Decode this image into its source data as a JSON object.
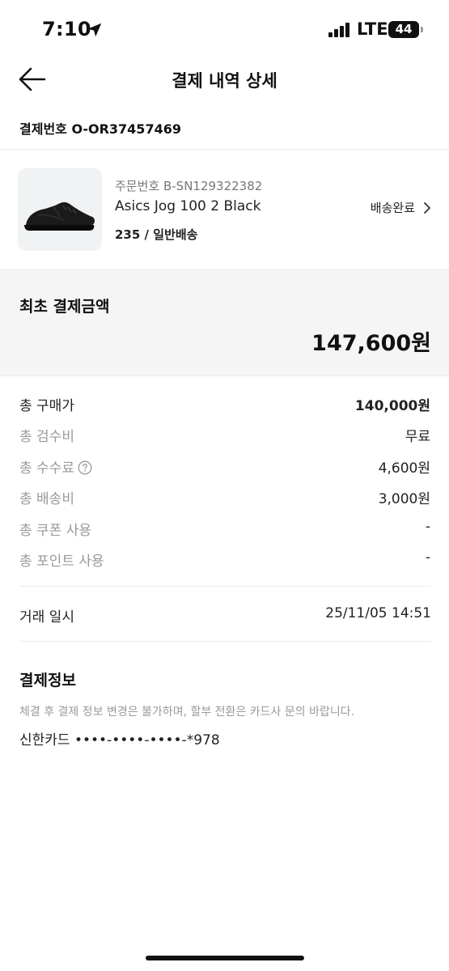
{
  "status_bar": {
    "time": "7:10",
    "network": "LTE",
    "battery": "44",
    "icons": {
      "location": "location-arrow-icon",
      "signal": "cellular-signal-icon",
      "battery": "battery-icon"
    }
  },
  "header": {
    "title": "결제 내역 상세",
    "back_icon": "arrow-left-icon"
  },
  "payment_number": "결제번호 O-OR37457469",
  "order": {
    "order_number": "주문번호 B-SN129322382",
    "product_name": "Asics Jog 100 2 Black",
    "option": "235 / 일반배송",
    "status": "배송완료",
    "status_icon": "chevron-right-icon",
    "thumbnail_icon": "sneaker-image"
  },
  "initial_payment": {
    "label": "최초 결제금액",
    "amount": "147,600원"
  },
  "fees": [
    {
      "label": "총 구매가",
      "value": "140,000원"
    },
    {
      "label": "총 검수비",
      "value": "무료"
    },
    {
      "label": "총 수수료",
      "value": "4,600원"
    },
    {
      "label": "총 배송비",
      "value": "3,000원"
    },
    {
      "label": "총 쿠폰 사용",
      "value": "-"
    },
    {
      "label": "총 포인트 사용",
      "value": "-"
    }
  ],
  "help_icon": "question-circle-icon",
  "trade": {
    "label": "거래 일시",
    "value": "25/11/05 14:51"
  },
  "payment_info": {
    "title": "결제정보",
    "notice": "체결 후 결제 정보 변경은 불가하며, 할부 전환은 카드사 문의 바랍니다.",
    "card": "신한카드 ••••-••••-••••-*978"
  },
  "colors": {
    "text": "#111111",
    "muted": "#999999",
    "panel_bg": "#f5f5f5",
    "divider": "#ececec"
  }
}
